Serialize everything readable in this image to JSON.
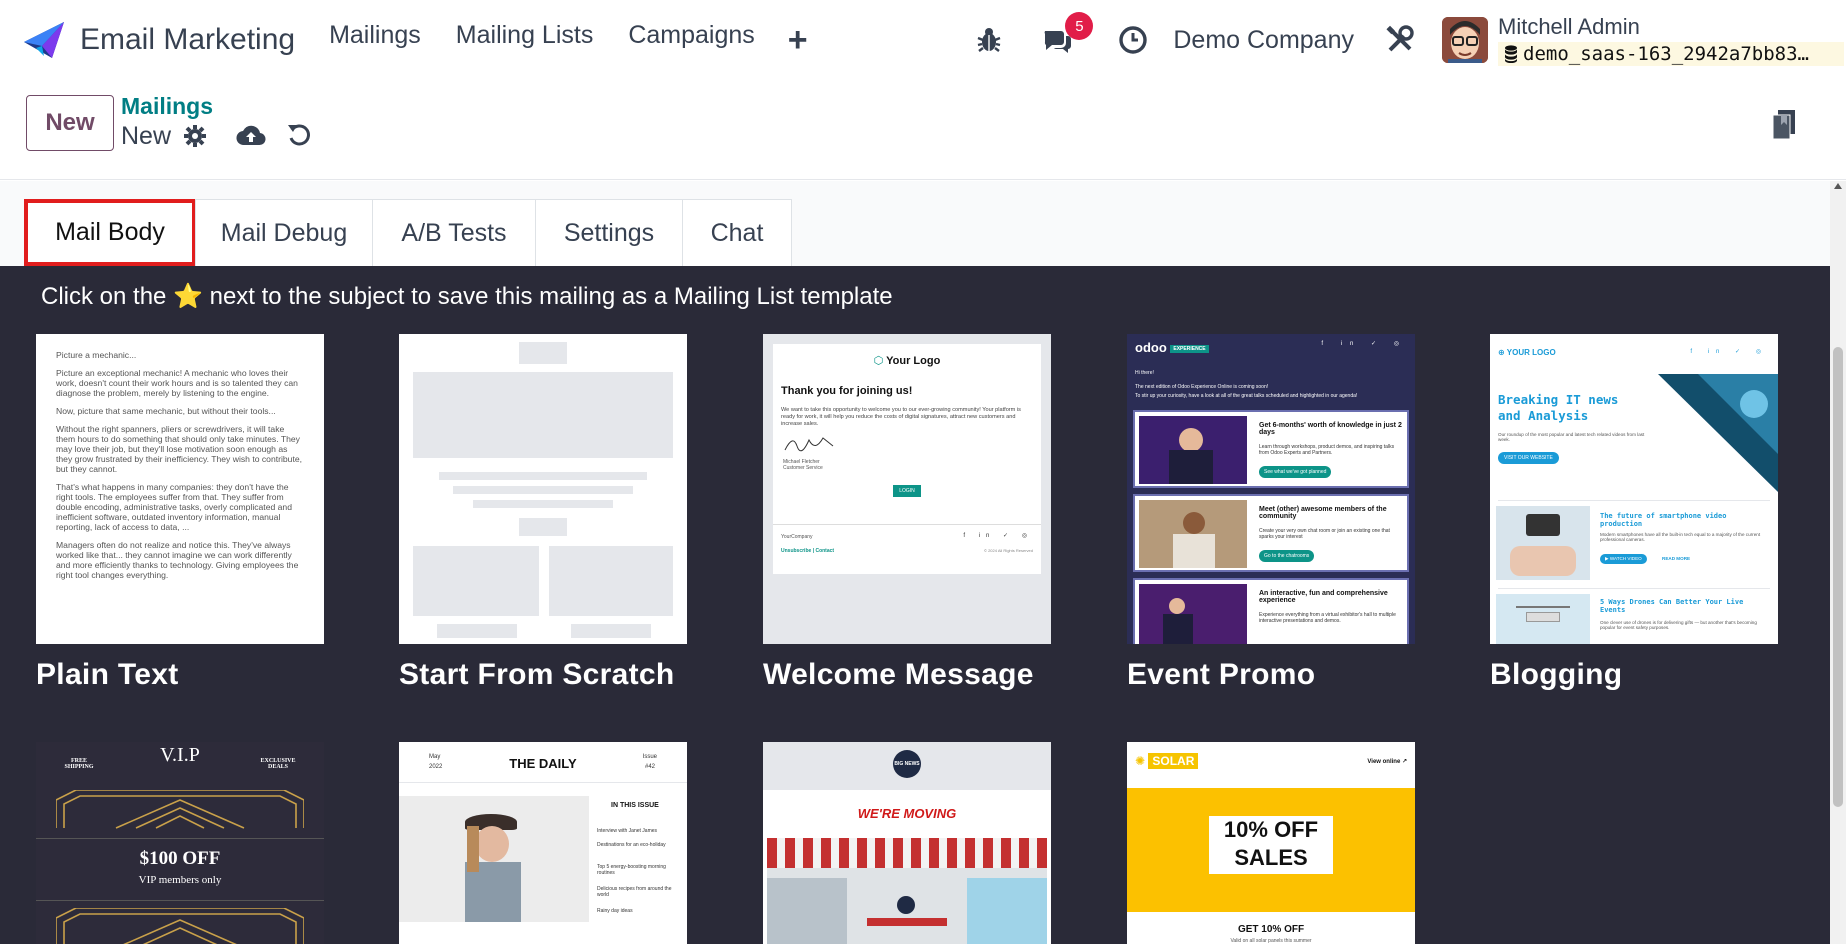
{
  "navbar": {
    "brand": "Email Marketing",
    "menu": [
      "Mailings",
      "Mailing Lists",
      "Campaigns"
    ],
    "add_label": "+",
    "chat_badge": "5",
    "company": "Demo Company",
    "user_name": "Mitchell Admin",
    "db_name": "demo_saas-163_2942a7bb83…"
  },
  "control": {
    "new_button": "New",
    "breadcrumb": "Mailings",
    "record_name": "New"
  },
  "tabs": [
    "Mail Body",
    "Mail Debug",
    "A/B Tests",
    "Settings",
    "Chat"
  ],
  "active_tab": "Mail Body",
  "hint": "Click on the ⭐ next to the subject to save this mailing as a Mailing List template",
  "templates": [
    {
      "name": "Plain Text"
    },
    {
      "name": "Start From Scratch"
    },
    {
      "name": "Welcome Message"
    },
    {
      "name": "Event Promo"
    },
    {
      "name": "Blogging"
    }
  ],
  "previews": {
    "plain_text": {
      "title": "Picture a mechanic...",
      "paragraphs": [
        "Picture an exceptional mechanic! A mechanic who loves their work, doesn't count their work hours and is so talented they can diagnose the problem, merely by listening to the engine.",
        "Now, picture that same mechanic, but without their tools...",
        "Without the right spanners, pliers or screwdrivers, it will take them hours to do something that should only take minutes. They may love their job, but they'll lose motivation soon enough as they grow frustrated by their inefficiency. They wish to contribute, but they cannot.",
        "That's what happens in many companies: they don't have the right tools. The employees suffer from that. They suffer from double encoding, administrative tasks, overly complicated and inefficient software, outdated inventory information, manual reporting, lack of access to data, ...",
        "Managers often do not realize and notice this. They've always worked like that... they cannot imagine we can work differently and more efficiently thanks to technology. Giving employees the right tool changes everything."
      ]
    },
    "welcome": {
      "logo": "Your Logo",
      "heading": "Thank you for joining us!",
      "body": "We want to take this opportunity to welcome you to our ever-growing community! Your platform is ready for work, it will help you reduce the costs of digital signatures, attract new customers and increase sales.",
      "signer": "Michael Fletcher",
      "signer_role": "Customer Service",
      "button": "LOGIN",
      "footer_company": "YourCompany",
      "footer_links": "Unsubscribe | Contact",
      "footer_copy": "© 2024 All Rights Reserved"
    },
    "event": {
      "logo": "odoo",
      "logo_tag": "EXPERIENCE",
      "greeting": "Hi there!",
      "intro1": "The next edition of Odoo Experience Online is coming soon!",
      "intro2": "To stir up your curiosity, have a look at all of the great talks scheduled and highlighted in our agenda!",
      "items": [
        {
          "title": "Get 6-months' worth of knowledge in just 2 days",
          "text": "Learn through workshops, product demos, and inspiring talks from Odoo Experts and Partners.",
          "button": "See what we've got planned"
        },
        {
          "title": "Meet (other) awesome members of the community",
          "text": "Create your very own chat room or join an existing one that sparks your interest",
          "button": "Go to the chatrooms"
        },
        {
          "title": "An interactive, fun and comprehensive experience",
          "text": "Experience everything from a virtual exhibitor's hall to multiple interactive presentations and demos."
        }
      ]
    },
    "blog": {
      "logo": "YOUR LOGO",
      "headline": "Breaking IT news and Analysis",
      "intro": "Our roundup of the most popular and latest tech related videos from last week.",
      "button": "VISIT OUR WEBSITE",
      "item1_title": "The future of smartphone video production",
      "item1_text": "Modern smartphones have all the built-in tech equal to a majority of the current professional cameras.",
      "item1_button": "WATCH VIDEO",
      "item1_link": "READ MORE",
      "item2_title": "5 Ways Drones Can Better Your Live Events",
      "item2_text": "One clever use of drones is for delivering gifts — but another that's becoming popular for event safety purposes."
    },
    "vip": {
      "left": "FREE SHIPPING",
      "title": "V.I.P",
      "right": "EXCLUSIVE DEALS",
      "offer": "$100 OFF",
      "sub": "VIP members only"
    },
    "daily": {
      "month": "May",
      "year": "2022",
      "title": "THE DAILY",
      "issue_label": "Issue",
      "issue": "#42",
      "section": "IN THIS ISSUE",
      "items": [
        "Interview with Janet James",
        "Destinations for an eco-holiday",
        "Top 5 energy-boosting morning routines",
        "Delicious recipes from around the world",
        "Rainy day ideas"
      ]
    },
    "moving": {
      "badge": "BIG NEWS",
      "title": "WE'RE MOVING"
    },
    "solar": {
      "logo": "SOLAR",
      "view_online": "View online",
      "promo_line1": "10% OFF",
      "promo_line2": "SALES",
      "bottom": "GET 10% OFF",
      "bottom_sub": "Valid on all solar panels this summer"
    }
  },
  "colors": {
    "brand": "#714b67",
    "teal": "#017e84",
    "dark_bg": "#2a2a38",
    "active_tab_border": "#e11d1d",
    "badge": "#e11d48"
  }
}
